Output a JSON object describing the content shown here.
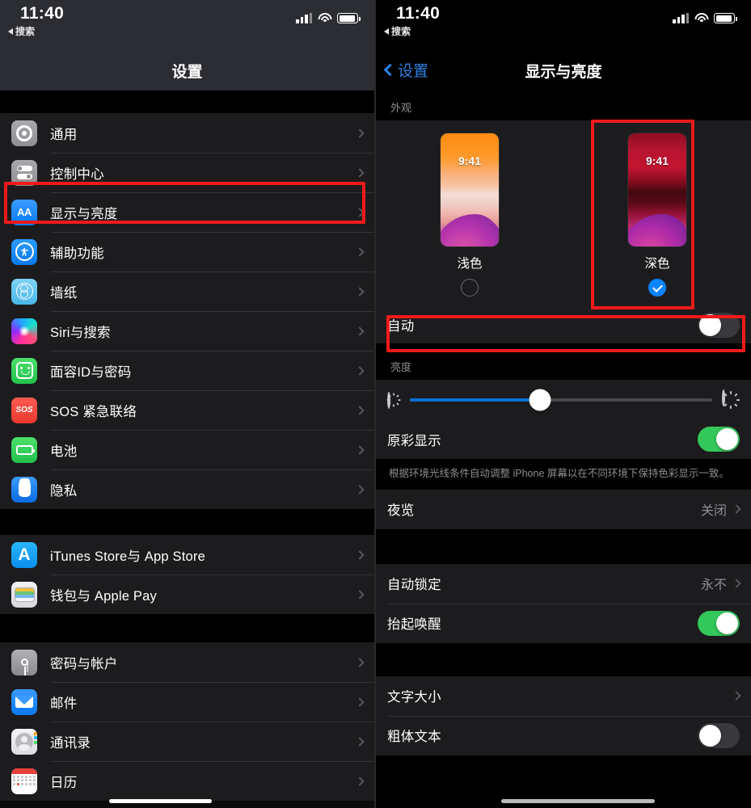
{
  "left_panel": {
    "status_bar": {
      "time": "11:40",
      "back_label": "搜索",
      "signal_icon": "cellular-signal-icon",
      "wifi_icon": "wifi-icon",
      "battery_icon": "battery-icon"
    },
    "nav": {
      "title": "设置"
    },
    "groups": [
      {
        "items": [
          {
            "label": "通用",
            "icon": "gear-icon",
            "name": "general"
          },
          {
            "label": "控制中心",
            "icon": "control-center-icon",
            "name": "control-center"
          },
          {
            "label": "显示与亮度",
            "icon": "display-brightness-icon",
            "name": "display-brightness",
            "highlighted": true
          },
          {
            "label": "辅助功能",
            "icon": "accessibility-icon",
            "name": "accessibility"
          },
          {
            "label": "墙纸",
            "icon": "wallpaper-icon",
            "name": "wallpaper"
          },
          {
            "label": "Siri与搜索",
            "icon": "siri-icon",
            "name": "siri-search"
          },
          {
            "label": "面容ID与密码",
            "icon": "face-id-icon",
            "name": "face-id-passcode"
          },
          {
            "label": "SOS 紧急联络",
            "icon": "sos-icon",
            "name": "emergency-sos"
          },
          {
            "label": "电池",
            "icon": "battery-app-icon",
            "name": "battery"
          },
          {
            "label": "隐私",
            "icon": "privacy-hand-icon",
            "name": "privacy"
          }
        ]
      },
      {
        "items": [
          {
            "label": "iTunes Store与 App Store",
            "icon": "app-store-icon",
            "name": "itunes-app-store"
          },
          {
            "label": "钱包与 Apple Pay",
            "icon": "wallet-icon",
            "name": "wallet-apple-pay"
          }
        ]
      },
      {
        "items": [
          {
            "label": "密码与帐户",
            "icon": "key-icon",
            "name": "passwords-accounts"
          },
          {
            "label": "邮件",
            "icon": "mail-icon",
            "name": "mail"
          },
          {
            "label": "通讯录",
            "icon": "contacts-icon",
            "name": "contacts"
          },
          {
            "label": "日历",
            "icon": "calendar-icon",
            "name": "calendar"
          }
        ]
      }
    ]
  },
  "right_panel": {
    "status_bar": {
      "time": "11:40",
      "back_label": "搜索"
    },
    "nav": {
      "back_label": "设置",
      "title": "显示与亮度"
    },
    "appearance": {
      "section_header": "外观",
      "themes": [
        {
          "name": "light",
          "label": "浅色",
          "preview_time": "9:41",
          "selected": false
        },
        {
          "name": "dark",
          "label": "深色",
          "preview_time": "9:41",
          "selected": true
        }
      ],
      "automatic": {
        "label": "自动",
        "enabled": false,
        "highlighted": true
      }
    },
    "brightness": {
      "section_header": "亮度",
      "slider": {
        "value_percent": 43,
        "low_icon": "sun-small-icon",
        "high_icon": "sun-large-icon"
      },
      "true_tone": {
        "label": "原彩显示",
        "enabled": true
      },
      "true_tone_footnote": "根据环境光线条件自动调整 iPhone 屏幕以在不同环境下保持色彩显示一致。"
    },
    "night_shift": {
      "label": "夜览",
      "value": "关闭"
    },
    "lock_group": [
      {
        "label": "自动锁定",
        "value": "永不",
        "type": "disclosure"
      },
      {
        "label": "抬起唤醒",
        "type": "toggle",
        "enabled": true
      }
    ],
    "text_group": [
      {
        "label": "文字大小",
        "type": "disclosure"
      },
      {
        "label": "粗体文本",
        "type": "toggle",
        "enabled": false
      }
    ]
  },
  "colors": {
    "accent_blue": "#0a84ff",
    "toggle_on_green": "#34c759",
    "annotation_red": "#f01a1a",
    "row_background": "#1c1c1e",
    "secondary_text": "#8e8e93"
  }
}
